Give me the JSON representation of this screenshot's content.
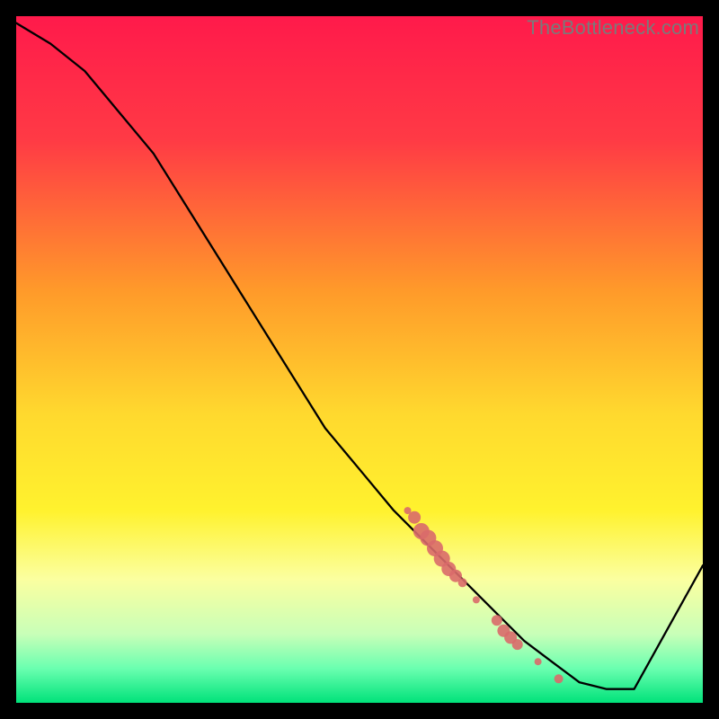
{
  "watermark": "TheBottleneck.com",
  "colors": {
    "gradient_top": "#ff1a4b",
    "gradient_mid1": "#ff8a2a",
    "gradient_mid2": "#ffe92e",
    "gradient_low": "#f6ffb0",
    "gradient_green_light": "#7aff9e",
    "gradient_green": "#00e27a",
    "line": "#000000",
    "dot": "#d96a6a",
    "frame": "#000000"
  },
  "chart_data": {
    "type": "line",
    "title": "",
    "xlabel": "",
    "ylabel": "",
    "xlim": [
      0,
      100
    ],
    "ylim": [
      0,
      100
    ],
    "series": [
      {
        "name": "curve",
        "x": [
          0,
          5,
          10,
          15,
          20,
          25,
          30,
          35,
          40,
          45,
          50,
          55,
          60,
          63,
          66,
          70,
          74,
          78,
          82,
          86,
          90,
          100
        ],
        "y": [
          99,
          96,
          92,
          86,
          80,
          72,
          64,
          56,
          48,
          40,
          34,
          28,
          23,
          20,
          17,
          13,
          9,
          6,
          3,
          2,
          2,
          20
        ]
      }
    ],
    "highlight_points": {
      "name": "dots",
      "points": [
        {
          "x": 57,
          "y": 28,
          "r": 4
        },
        {
          "x": 58,
          "y": 27,
          "r": 7
        },
        {
          "x": 59,
          "y": 25,
          "r": 9
        },
        {
          "x": 60,
          "y": 24,
          "r": 9
        },
        {
          "x": 61,
          "y": 22.5,
          "r": 9
        },
        {
          "x": 62,
          "y": 21,
          "r": 9
        },
        {
          "x": 63,
          "y": 19.5,
          "r": 8
        },
        {
          "x": 64,
          "y": 18.5,
          "r": 7
        },
        {
          "x": 65,
          "y": 17.5,
          "r": 5
        },
        {
          "x": 67,
          "y": 15,
          "r": 4
        },
        {
          "x": 70,
          "y": 12,
          "r": 6
        },
        {
          "x": 71,
          "y": 10.5,
          "r": 7
        },
        {
          "x": 72,
          "y": 9.5,
          "r": 7
        },
        {
          "x": 73,
          "y": 8.5,
          "r": 6
        },
        {
          "x": 76,
          "y": 6,
          "r": 4
        },
        {
          "x": 79,
          "y": 3.5,
          "r": 5
        }
      ]
    }
  }
}
